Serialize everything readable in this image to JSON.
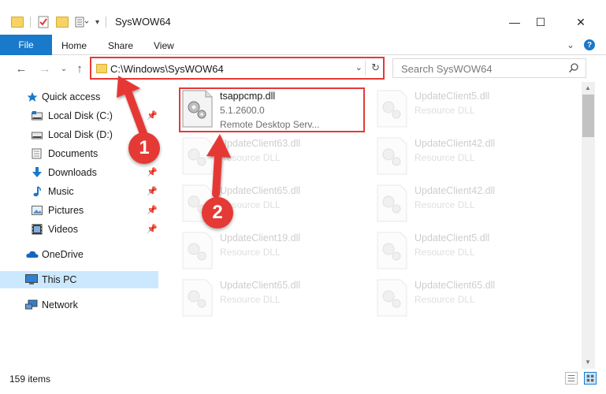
{
  "window": {
    "title": "SysWOW64",
    "minimize": "—",
    "maximize": "☐",
    "close": "✕"
  },
  "ribbon": {
    "file_tab": "File",
    "tabs": [
      "Home",
      "Share",
      "View"
    ],
    "expand": "⌄",
    "help": "?"
  },
  "address": {
    "path": "C:\\Windows\\SysWOW64",
    "dropdown": "⌄",
    "refresh": "↻"
  },
  "search": {
    "placeholder": "Search SysWOW64"
  },
  "nav": {
    "back": "←",
    "forward": "→",
    "recent": "⌄",
    "up": "↑"
  },
  "sidebar": {
    "items": [
      {
        "label": "Quick access",
        "icon": "star-icon"
      },
      {
        "label": "Local Disk (C:)",
        "icon": "drive-icon",
        "pinned": true
      },
      {
        "label": "Local Disk (D:)",
        "icon": "drive-icon",
        "pinned": true
      },
      {
        "label": "Documents",
        "icon": "documents-icon",
        "pinned": true
      },
      {
        "label": "Downloads",
        "icon": "download-icon",
        "pinned": true
      },
      {
        "label": "Music",
        "icon": "music-icon",
        "pinned": true
      },
      {
        "label": "Pictures",
        "icon": "pictures-icon",
        "pinned": true
      },
      {
        "label": "Videos",
        "icon": "videos-icon",
        "pinned": true
      },
      {
        "label": "OneDrive",
        "icon": "cloud-icon"
      },
      {
        "label": "This PC",
        "icon": "computer-icon",
        "selected": true
      },
      {
        "label": "Network",
        "icon": "network-icon"
      }
    ]
  },
  "files": {
    "highlighted": {
      "name": "tsappcmp.dll",
      "version": "5.1.2600.0",
      "description": "Remote Desktop Serv..."
    },
    "faded": [
      {
        "name": "UpdateClient5.dll",
        "desc": "Resource DLL"
      },
      {
        "name": "UpdateClient63.dll",
        "desc": "Resource DLL"
      },
      {
        "name": "UpdateClient42.dll",
        "desc": "Resource DLL"
      },
      {
        "name": "UpdateClient65.dll",
        "desc": "Resource DLL"
      },
      {
        "name": "UpdateClient42.dll",
        "desc": "Resource DLL"
      },
      {
        "name": "UpdateClient19.dll",
        "desc": "Resource DLL"
      },
      {
        "name": "UpdateClient5.dll",
        "desc": "Resource DLL"
      },
      {
        "name": "UpdateClient65.dll",
        "desc": "Resource DLL"
      },
      {
        "name": "UpdateClient65.dll",
        "desc": "Resource DLL"
      }
    ]
  },
  "status": {
    "item_count": "159 items"
  },
  "annotations": {
    "step1": "1",
    "step2": "2"
  },
  "colors": {
    "accent": "#1979ca",
    "highlight_red": "#e53935",
    "selection": "#cce8ff"
  }
}
